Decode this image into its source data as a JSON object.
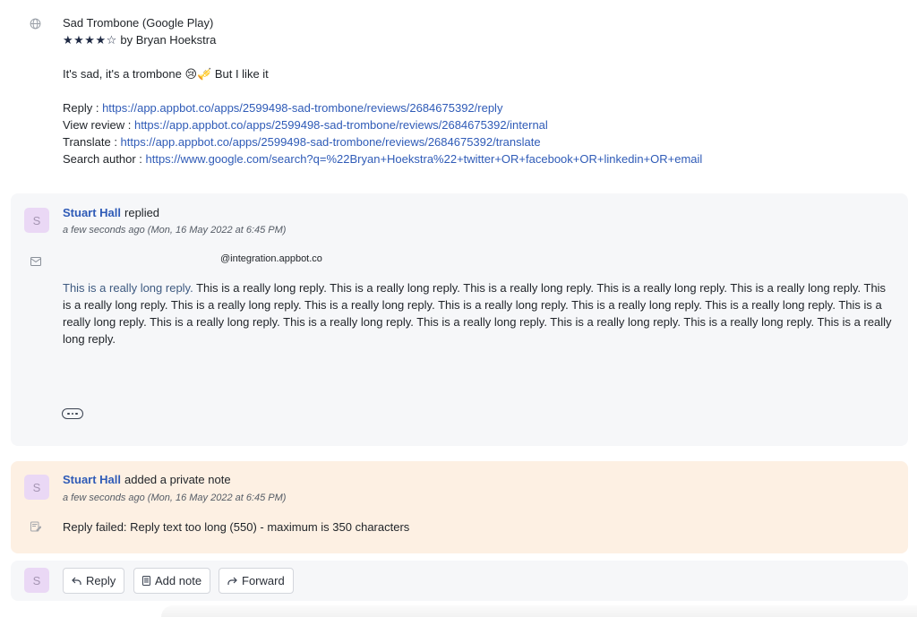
{
  "review": {
    "icon": "globe-icon",
    "app_title": "Sad Trombone (Google Play)",
    "rating": 4,
    "rating_max": 5,
    "stars_text": "★★★★☆",
    "byline": " by Bryan Hoekstra",
    "text": "It's sad, it's a trombone 😢🎺 But I like it",
    "links": [
      {
        "label": "Reply : ",
        "url": "https://app.appbot.co/apps/2599498-sad-trombone/reviews/2684675392/reply"
      },
      {
        "label": "View review : ",
        "url": "https://app.appbot.co/apps/2599498-sad-trombone/reviews/2684675392/internal"
      },
      {
        "label": "Translate : ",
        "url": "https://app.appbot.co/apps/2599498-sad-trombone/reviews/2684675392/translate"
      },
      {
        "label": "Search author : ",
        "url": "https://www.google.com/search?q=%22Bryan+Hoekstra%22+twitter+OR+facebook+OR+linkedin+OR+email"
      }
    ]
  },
  "reply_event": {
    "avatar_initial": "S",
    "author": "Stuart Hall",
    "action": "replied",
    "timestamp": "a few seconds ago (Mon, 16 May 2022 at 6:45 PM)",
    "email": "@integration.appbot.co",
    "first_sentence": "This is a really long reply.",
    "rest_text": " This is a really long reply. This is a really long reply. This is a really long reply. This is a really long reply. This is a really long reply. This is a really long reply. This is a really long reply. This is a really long reply. This is a really long reply. This is a really long reply. This is a really long reply. This is a really long reply. This is a really long reply. This is a really long reply. This is a really long reply. This is a really long reply. This is a really long reply. This is a really long reply."
  },
  "note_event": {
    "avatar_initial": "S",
    "author": "Stuart Hall",
    "action": "added a private note",
    "timestamp": "a few seconds ago (Mon, 16 May 2022 at 6:45 PM)",
    "text": "Reply failed: Reply text too long (550) - maximum is 350 characters"
  },
  "actions": {
    "avatar_initial": "S",
    "reply_label": "Reply",
    "add_note_label": "Add note",
    "forward_label": "Forward"
  },
  "colors": {
    "link": "#2f5bb7",
    "reply_card_bg": "#f6f7f9",
    "note_card_bg": "#fdf0e3",
    "avatar_bg": "#ead8f5"
  }
}
